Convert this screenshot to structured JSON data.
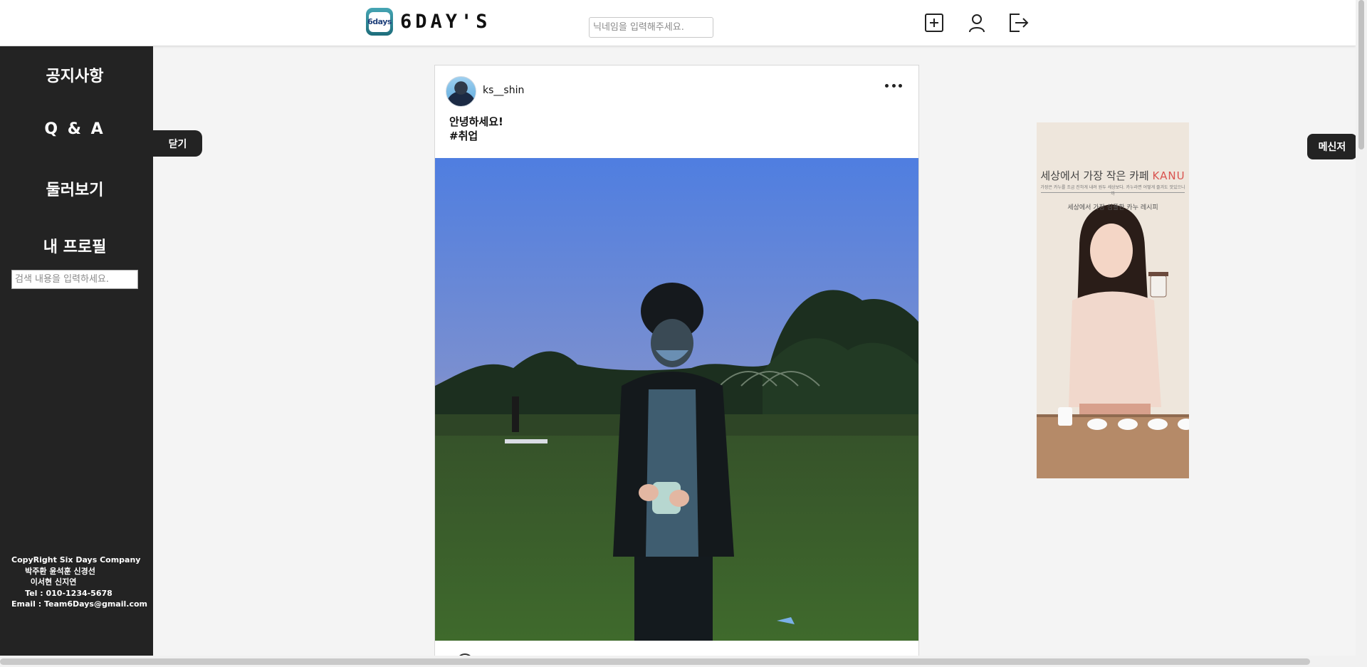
{
  "header": {
    "logo_badge": "6days",
    "logo_text": "6DAY'S",
    "nickname_placeholder": "닉네임을 입력해주세요.",
    "icons": [
      "add-post-icon",
      "profile-icon",
      "logout-icon"
    ]
  },
  "sidebar": {
    "items": [
      {
        "label": "공지사항"
      },
      {
        "label": "Q & A"
      },
      {
        "label": "둘러보기"
      },
      {
        "label": "내 프로필"
      }
    ],
    "search_placeholder": "검색 내용을 입력하세요.",
    "footer": "CopyRight Six Days Company\n     박주환 윤석훈 신경선\n       이서현 신지연\n     Tel : 010-1234-5678\nEmail : Team6Days@gmail.com"
  },
  "buttons": {
    "close_label": "닫기",
    "messenger_label": "메신저"
  },
  "post": {
    "username": "ks__shin",
    "caption_line1": "안녕하세요!",
    "caption_line2": "#취업",
    "image_description_icon": "post-photo"
  },
  "ad": {
    "title": "세상에서 가장 작은 카페",
    "brand": "KANU",
    "subtitle": "가장은 카누를 조금 진하게 내려 원두 세상보다. 카누라면 어떻게 즐겨도 맛있으니까",
    "tagline": "세상에서 가장 심플한 카누 레시피"
  },
  "colors": {
    "sidebar_bg": "#232323",
    "page_bg": "#f4f4f4",
    "logo_teal": "#2b8a99",
    "ad_brand": "#d9534f"
  }
}
